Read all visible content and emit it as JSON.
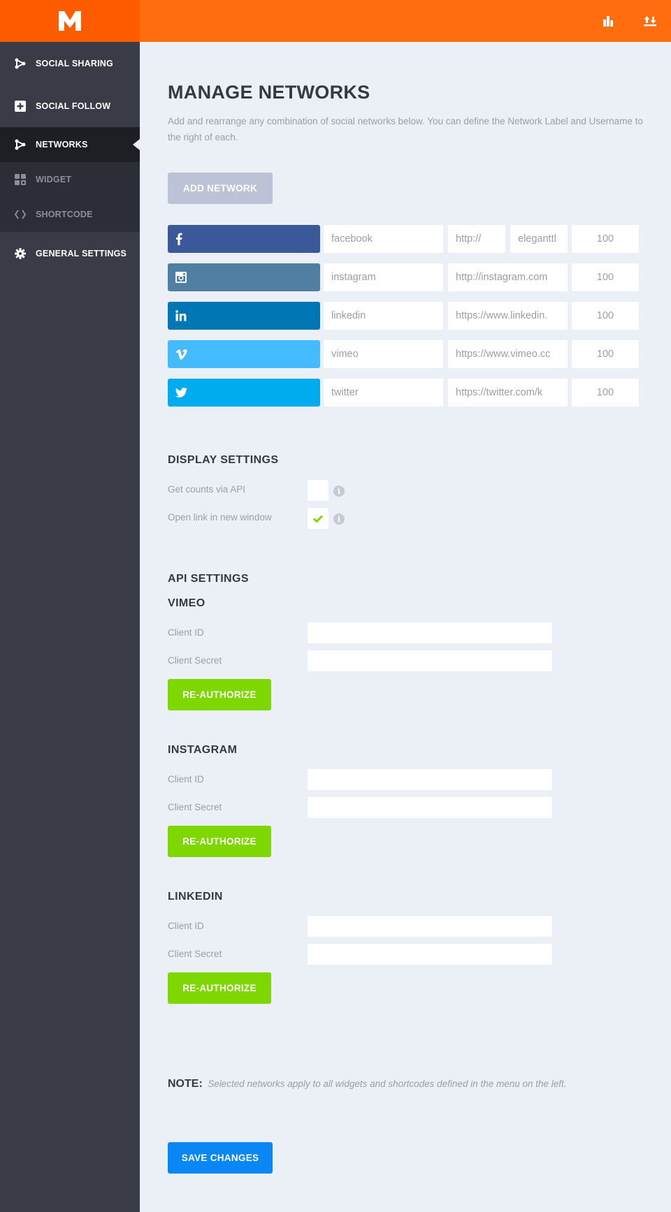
{
  "app": {
    "logo_letter": "M",
    "brand_color": "#ff5c00",
    "topbar_color": "#ff6d0f"
  },
  "topbar": {
    "actions": [
      {
        "icon": "bar-chart-icon",
        "label": "Statistics"
      },
      {
        "icon": "import-export-icon",
        "label": "Import / Export"
      }
    ]
  },
  "sidebar": {
    "items": [
      {
        "label": "SOCIAL SHARING",
        "icon": "share-icon",
        "active": false,
        "sub": false
      },
      {
        "label": "SOCIAL FOLLOW",
        "icon": "plus-square-icon",
        "active": false,
        "sub": false
      },
      {
        "label": "NETWORKS",
        "icon": "share-icon",
        "active": true,
        "sub": true
      },
      {
        "label": "WIDGET",
        "icon": "widget-grid-icon",
        "active": false,
        "sub": true
      },
      {
        "label": "SHORTCODE",
        "icon": "code-icon",
        "active": false,
        "sub": true
      },
      {
        "label": "GENERAL SETTINGS",
        "icon": "gear-icon",
        "active": false,
        "sub": false
      }
    ]
  },
  "main": {
    "title": "MANAGE NETWORKS",
    "description": "Add and rearrange any combination of social networks below. You can define the Network Label and Username to the right of each.",
    "add_network_label": "ADD NETWORK",
    "networks": [
      {
        "name": "facebook",
        "icon": "facebook-icon",
        "color": "#3b5998",
        "label": "facebook",
        "url_prefix": "http://",
        "username": "eleganttl",
        "count": "100"
      },
      {
        "name": "instagram",
        "icon": "instagram-icon",
        "color": "#517fa4",
        "label": "instagram",
        "url": "http://instagram.com",
        "count": "100"
      },
      {
        "name": "linkedin",
        "icon": "linkedin-icon",
        "color": "#0077b5",
        "label": "linkedin",
        "url": "https://www.linkedin.",
        "count": "100"
      },
      {
        "name": "vimeo",
        "icon": "vimeo-icon",
        "color": "#45bbff",
        "label": "vimeo",
        "url": "https://www.vimeo.cc",
        "count": "100"
      },
      {
        "name": "twitter",
        "icon": "twitter-icon",
        "color": "#00aced",
        "label": "twitter",
        "url": "https://twitter.com/k",
        "count": "100"
      }
    ],
    "display_settings": {
      "heading": "DISPLAY SETTINGS",
      "options": [
        {
          "label": "Get counts via API",
          "checked": false
        },
        {
          "label": "Open link in new window",
          "checked": true
        }
      ]
    },
    "api_settings": {
      "heading": "API SETTINGS",
      "groups": [
        {
          "title": "VIMEO",
          "client_id_label": "Client ID",
          "client_id": "",
          "client_secret_label": "Client Secret",
          "client_secret": "",
          "button": "RE-AUTHORIZE"
        },
        {
          "title": "INSTAGRAM",
          "client_id_label": "Client ID",
          "client_id": "",
          "client_secret_label": "Client Secret",
          "client_secret": "",
          "button": "RE-AUTHORIZE"
        },
        {
          "title": "LINKEDIN",
          "client_id_label": "Client ID",
          "client_id": "",
          "client_secret_label": "Client Secret",
          "client_secret": "",
          "button": "RE-AUTHORIZE"
        }
      ]
    },
    "note_label": "NOTE:",
    "note_text": "Selected networks apply to all widgets and shortcodes defined in the menu on the left.",
    "save_label": "SAVE CHANGES",
    "colors": {
      "check": "#7ed700",
      "reauthorize": "#7ed700",
      "save": "#0a87f5",
      "add_network": "#bcc3d6"
    }
  }
}
